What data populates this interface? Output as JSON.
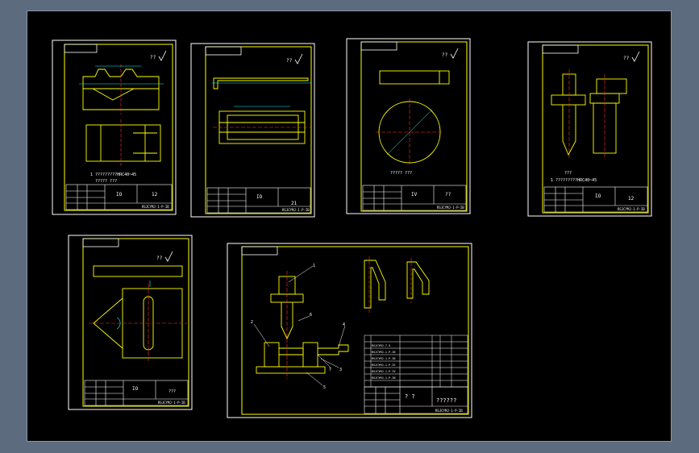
{
  "colors": {
    "background": "#5d6b7e",
    "canvas": "#000000",
    "border": "#ffffff",
    "drawing": "#ffff00",
    "dim": "#00ffff",
    "text": "#ffffff",
    "center": "#ff3030"
  },
  "sheets": [
    {
      "id": "sheet-1",
      "roughness": "??",
      "note": "1 ?????????HRC40~45",
      "note2": "????? ???",
      "title_block": {
        "part": "IO",
        "scale": "12",
        "drawing_no": "RSJCYMJ-1-P-IB"
      }
    },
    {
      "id": "sheet-2",
      "roughness": "??",
      "note": "",
      "title_block": {
        "part": "IO",
        "scale": "21",
        "drawing_no": "RSJCYMJ-1-P-IB"
      }
    },
    {
      "id": "sheet-3",
      "roughness": "??",
      "note": "????? ???",
      "title_block": {
        "part": "IV",
        "scale": "??",
        "drawing_no": "RSJCYMJ-1-P-IB"
      }
    },
    {
      "id": "sheet-4",
      "roughness": "??",
      "note": "1 ?????????HRC40~45",
      "note2": "???",
      "title_block": {
        "part": "IO",
        "scale": "12",
        "drawing_no": "RSJCYMJ-1-P-IB"
      }
    },
    {
      "id": "sheet-5",
      "roughness": "??",
      "note": "",
      "title_block": {
        "part": "IO",
        "scale": "???",
        "drawing_no": "RSJCYMJ-1-P-IB"
      }
    },
    {
      "id": "sheet-6",
      "roughness": "??",
      "leaders": [
        "1",
        "2",
        "3",
        "4",
        "5",
        "6",
        "7"
      ],
      "bom": [
        "RSJCYMJ-7-5",
        "RSJCYMJ-1-P-I6",
        "RSJCYMJ-1-P-IB",
        "RSJCYMJ-1-P-IS",
        "RSJCYMJ-1-P-IV",
        "RSJCYMJ-1-P-IB"
      ],
      "title_block": {
        "part": "? ?",
        "scale": "??????",
        "drawing_no": "RSJCYMJ-1-P-IB"
      }
    }
  ]
}
